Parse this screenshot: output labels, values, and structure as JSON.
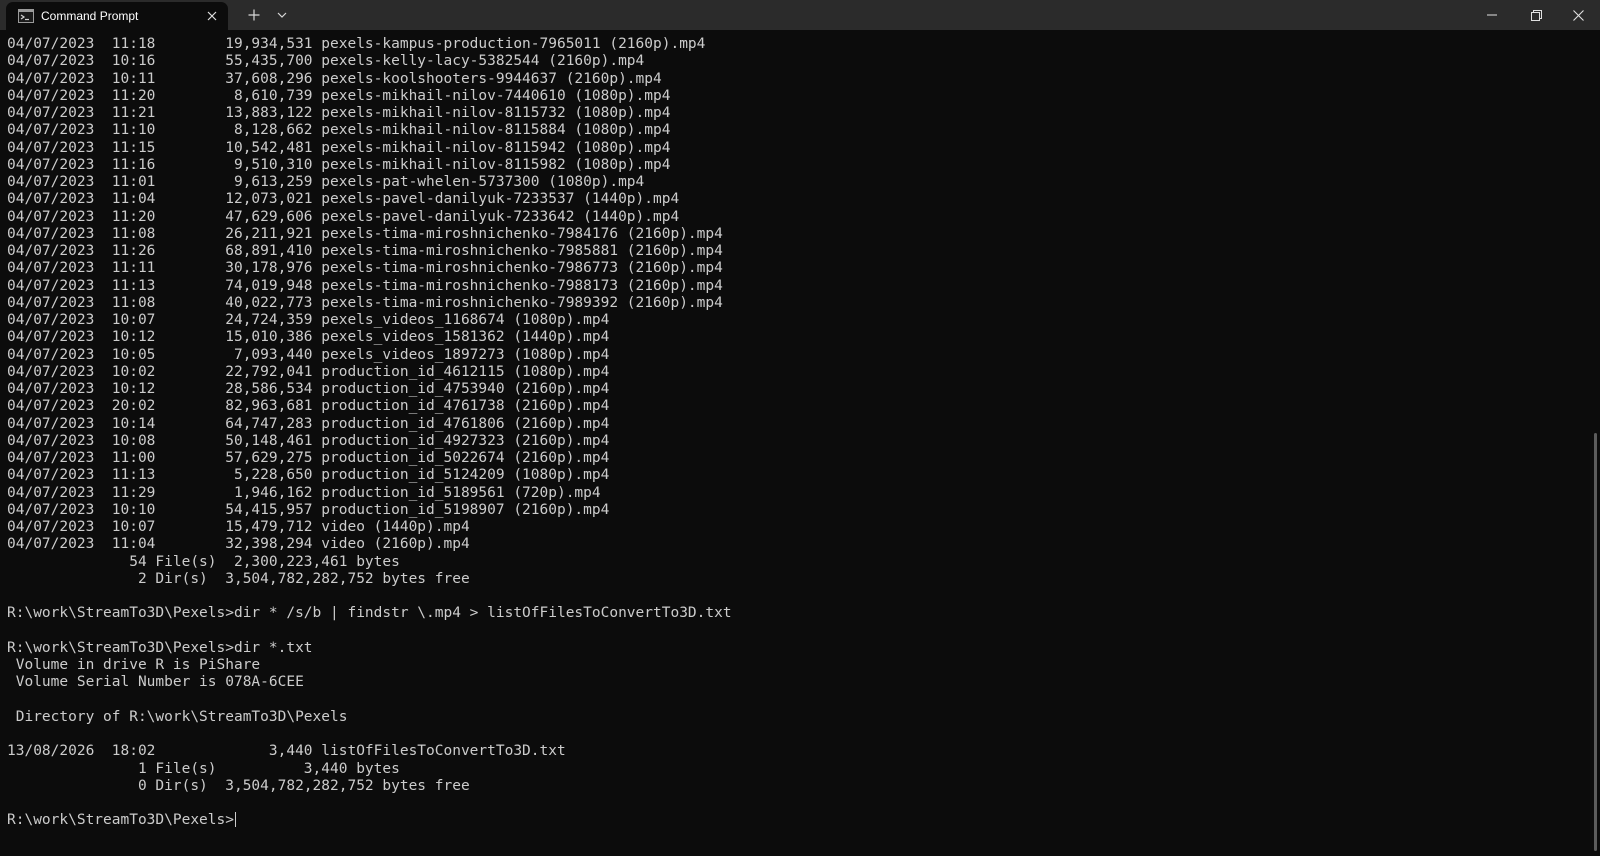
{
  "window": {
    "tab_title": "Command Prompt",
    "tab_icon": "terminal-icon",
    "controls": [
      "new-tab-icon",
      "dropdown-chevron-icon",
      "minimize-icon",
      "restore-icon",
      "close-icon"
    ]
  },
  "colors": {
    "background": "#0c0c0c",
    "text": "#cccccc",
    "titlebar": "#2b2b2b"
  },
  "terminal": {
    "lines": [
      "04/07/2023  11:18        19,934,531 pexels-kampus-production-7965011 (2160p).mp4",
      "04/07/2023  10:16        55,435,700 pexels-kelly-lacy-5382544 (2160p).mp4",
      "04/07/2023  10:11        37,608,296 pexels-koolshooters-9944637 (2160p).mp4",
      "04/07/2023  11:20         8,610,739 pexels-mikhail-nilov-7440610 (1080p).mp4",
      "04/07/2023  11:21        13,883,122 pexels-mikhail-nilov-8115732 (1080p).mp4",
      "04/07/2023  11:10         8,128,662 pexels-mikhail-nilov-8115884 (1080p).mp4",
      "04/07/2023  11:15        10,542,481 pexels-mikhail-nilov-8115942 (1080p).mp4",
      "04/07/2023  11:16         9,510,310 pexels-mikhail-nilov-8115982 (1080p).mp4",
      "04/07/2023  11:01         9,613,259 pexels-pat-whelen-5737300 (1080p).mp4",
      "04/07/2023  11:04        12,073,021 pexels-pavel-danilyuk-7233537 (1440p).mp4",
      "04/07/2023  11:20        47,629,606 pexels-pavel-danilyuk-7233642 (1440p).mp4",
      "04/07/2023  11:08        26,211,921 pexels-tima-miroshnichenko-7984176 (2160p).mp4",
      "04/07/2023  11:26        68,891,410 pexels-tima-miroshnichenko-7985881 (2160p).mp4",
      "04/07/2023  11:11        30,178,976 pexels-tima-miroshnichenko-7986773 (2160p).mp4",
      "04/07/2023  11:13        74,019,948 pexels-tima-miroshnichenko-7988173 (2160p).mp4",
      "04/07/2023  11:08        40,022,773 pexels-tima-miroshnichenko-7989392 (2160p).mp4",
      "04/07/2023  10:07        24,724,359 pexels_videos_1168674 (1080p).mp4",
      "04/07/2023  10:12        15,010,386 pexels_videos_1581362 (1440p).mp4",
      "04/07/2023  10:05         7,093,440 pexels_videos_1897273 (1080p).mp4",
      "04/07/2023  10:02        22,792,041 production_id_4612115 (1080p).mp4",
      "04/07/2023  10:12        28,586,534 production_id_4753940 (2160p).mp4",
      "04/07/2023  20:02        82,963,681 production_id_4761738 (2160p).mp4",
      "04/07/2023  10:14        64,747,283 production_id_4761806 (2160p).mp4",
      "04/07/2023  10:08        50,148,461 production_id_4927323 (2160p).mp4",
      "04/07/2023  11:00        57,629,275 production_id_5022674 (2160p).mp4",
      "04/07/2023  11:13         5,228,650 production_id_5124209 (1080p).mp4",
      "04/07/2023  11:29         1,946,162 production_id_5189561 (720p).mp4",
      "04/07/2023  10:10        54,415,957 production_id_5198907 (2160p).mp4",
      "04/07/2023  10:07        15,479,712 video (1440p).mp4",
      "04/07/2023  11:04        32,398,294 video (2160p).mp4",
      "              54 File(s)  2,300,223,461 bytes",
      "               2 Dir(s)  3,504,782,282,752 bytes free",
      "",
      "R:\\work\\StreamTo3D\\Pexels>dir * /s/b | findstr \\.mp4 > listOfFilesToConvertTo3D.txt",
      "",
      "R:\\work\\StreamTo3D\\Pexels>dir *.txt",
      " Volume in drive R is PiShare",
      " Volume Serial Number is 078A-6CEE",
      "",
      " Directory of R:\\work\\StreamTo3D\\Pexels",
      "",
      "13/08/2026  18:02             3,440 listOfFilesToConvertTo3D.txt",
      "               1 File(s)          3,440 bytes",
      "               0 Dir(s)  3,504,782,282,752 bytes free",
      ""
    ],
    "prompt": "R:\\work\\StreamTo3D\\Pexels>"
  }
}
